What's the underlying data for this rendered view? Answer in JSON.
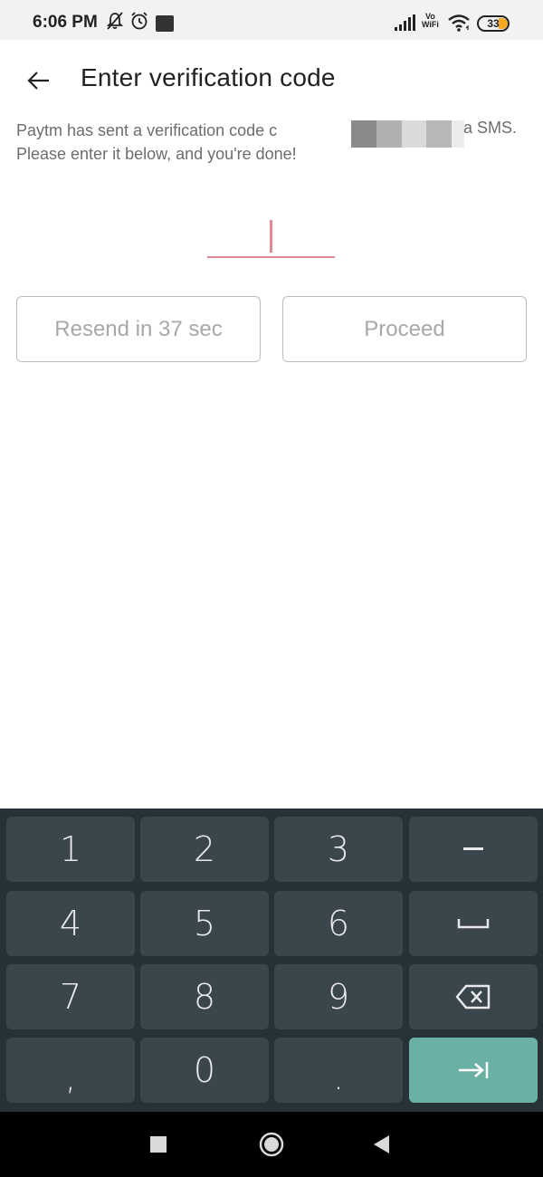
{
  "status_bar": {
    "time": "6:06 PM",
    "network_label": "Vo\nWiFi",
    "battery_level": "33",
    "icons": [
      "bell-off-icon",
      "alarm-icon",
      "app-notification-icon",
      "signal-icon",
      "vowifi-icon",
      "wifi-icon",
      "battery-icon"
    ]
  },
  "header": {
    "title": "Enter verification code",
    "back_icon": "arrow-left-icon"
  },
  "description": {
    "line1": "Paytm has sent a verification code c",
    "line2": "Please enter it below, and you're done!",
    "tail": "a SMS."
  },
  "otp": {
    "value": ""
  },
  "buttons": {
    "resend_label": "Resend in 37 sec",
    "proceed_label": "Proceed"
  },
  "keyboard": {
    "keys": [
      [
        "1",
        "2",
        "3",
        "–"
      ],
      [
        "4",
        "5",
        "6",
        "space"
      ],
      [
        "7",
        "8",
        "9",
        "backspace"
      ],
      [
        ",",
        "0",
        ".",
        "next"
      ]
    ],
    "accent_color": "#6ab0a5",
    "key_color": "#3b454c",
    "background_color": "#263238"
  },
  "nav_bar": {
    "icons": [
      "recents-square-icon",
      "home-circle-icon",
      "back-triangle-icon"
    ]
  }
}
